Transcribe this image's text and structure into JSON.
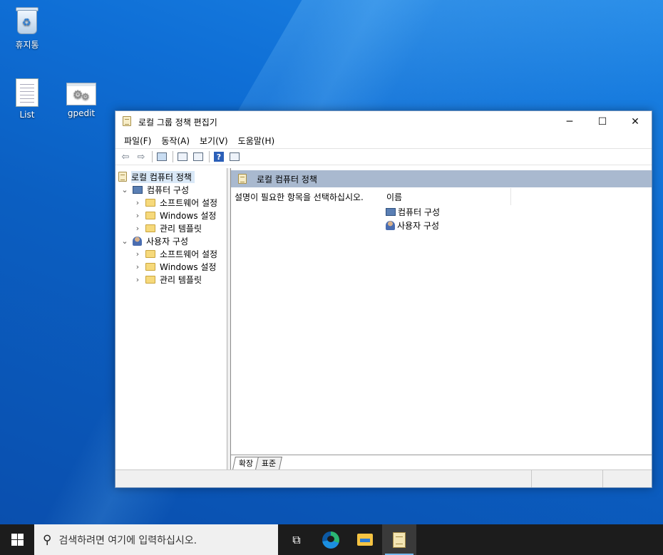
{
  "desktop": {
    "icons": [
      {
        "label": "휴지통",
        "icon": "recycle-bin-icon"
      },
      {
        "label": "List",
        "icon": "text-document-icon"
      },
      {
        "label": "gpedit",
        "icon": "gpedit-shortcut-icon"
      }
    ]
  },
  "window": {
    "title": "로컬 그룹 정책 편집기",
    "controls": {
      "minimize": "─",
      "maximize": "☐",
      "close": "✕"
    },
    "menu": [
      "파일(F)",
      "동작(A)",
      "보기(V)",
      "도움말(H)"
    ],
    "toolbar": {
      "back": "⇦",
      "forward": "⇨",
      "help": "?"
    },
    "tree": {
      "root": "로컬 컴퓨터 정책",
      "computer_config": "컴퓨터 구성",
      "user_config": "사용자 구성",
      "computer_children": [
        "소프트웨어 설정",
        "Windows 설정",
        "관리 템플릿"
      ],
      "user_children": [
        "소프트웨어 설정",
        "Windows 설정",
        "관리 템플릿"
      ],
      "expanded_chevron": "⌄",
      "collapsed_chevron": "›"
    },
    "detail": {
      "header": "로컬 컴퓨터 정책",
      "description": "설명이 필요한 항목을 선택하십시오.",
      "column_name": "이름",
      "items": [
        "컴퓨터 구성",
        "사용자 구성"
      ]
    },
    "tabs": [
      "확장",
      "표준"
    ]
  },
  "taskbar": {
    "search_placeholder": "검색하려면 여기에 입력하십시오.",
    "apps": [
      "task-view-icon",
      "edge-icon",
      "file-explorer-icon",
      "group-policy-editor-icon"
    ]
  }
}
